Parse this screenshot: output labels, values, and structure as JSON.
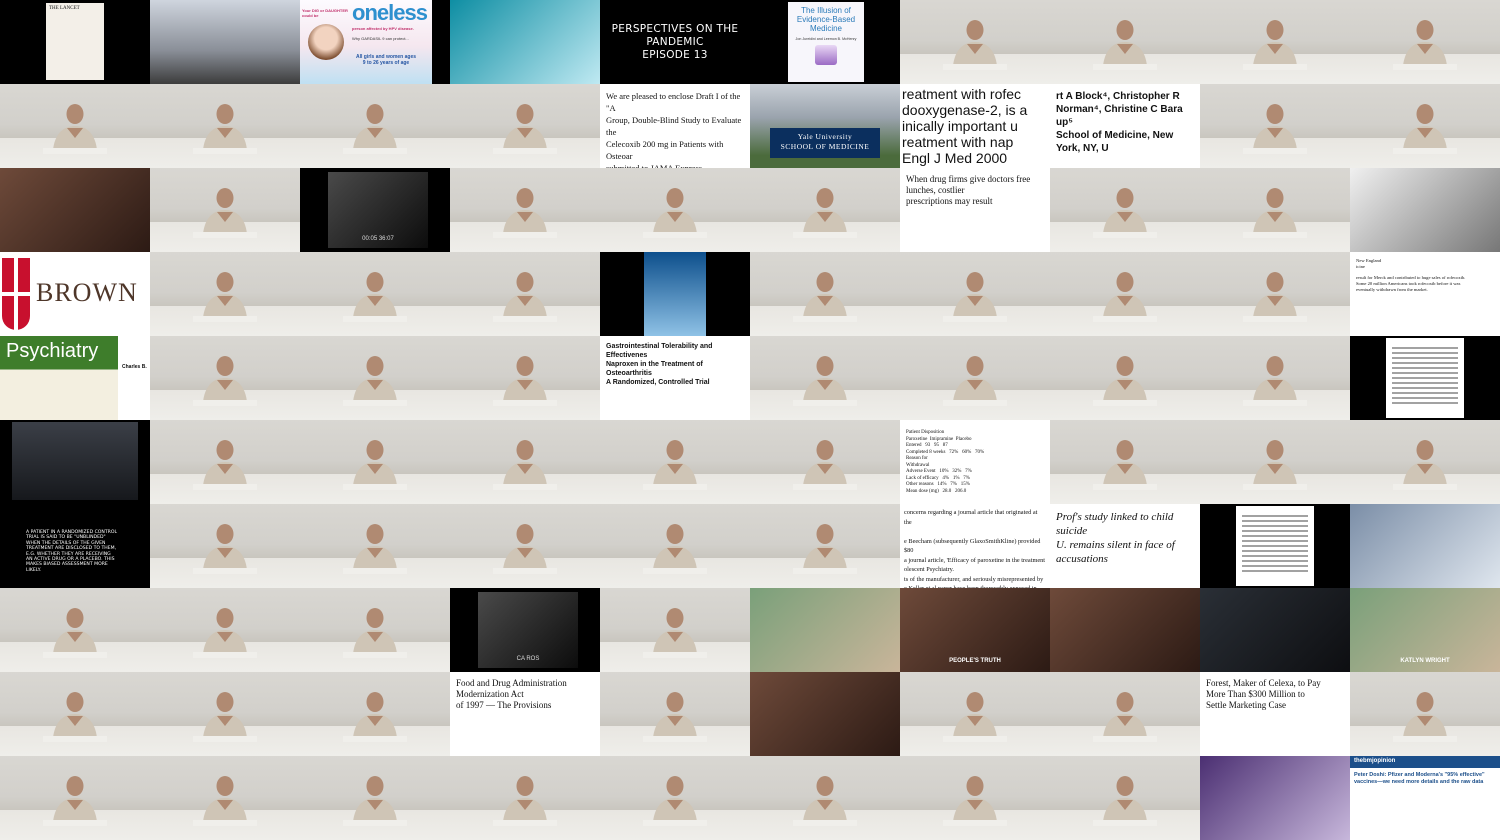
{
  "tiles": [
    {
      "type": "doc",
      "text": "THE LANCET"
    },
    {
      "type": "photo",
      "variant": "photo-street"
    },
    {
      "type": "ad",
      "brand": "oneless",
      "top": "Your DIG or DAUGHTER could be",
      "sub": "person affected by HPV disease.",
      "mid": "Why GARDASIL 9 can protect...",
      "low": "All girls and women ages\n9 to 26 years of age"
    },
    {
      "type": "photo",
      "variant": "photo-cyan"
    },
    {
      "type": "title",
      "line1": "PERSPECTIVES ON THE PANDEMIC",
      "line2": "EPISODE 13"
    },
    {
      "type": "book",
      "title": "The Illusion of\nEvidence-Based\nMedicine",
      "authors": "Jon Jureidini and Leemon B. McHenry"
    },
    {
      "type": "speaker"
    },
    {
      "type": "speaker"
    },
    {
      "type": "speaker"
    },
    {
      "type": "speaker"
    },
    {
      "type": "speaker"
    },
    {
      "type": "speaker"
    },
    {
      "type": "speaker"
    },
    {
      "type": "speaker"
    },
    {
      "type": "doc",
      "text": "We are pleased to enclose Draft I of the \"A\nGroup, Double-Blind Study to Evaluate the\nCelecoxib 200 mg in Patients with Osteoar\nsubmitted to JAMA Express.\n\nPlease feel free to mark your revisions direc\n\nWe look forward to receiving your commen"
    },
    {
      "type": "sign",
      "text": "Yale University\nSCHOOL OF MEDICINE"
    },
    {
      "type": "doc",
      "text": "reatment with rofec\ndooxygenase-2, is a\ninically important u\nreatment with nap\nEngl J Med 2000"
    },
    {
      "type": "doc",
      "text": "rt A Block⁴, Christopher R\nNorman⁴, Christine C Bara\nup⁵\nSchool of Medicine, New York, NY, U"
    },
    {
      "type": "speaker"
    },
    {
      "type": "speaker"
    },
    {
      "type": "photo",
      "variant": "photo-warm"
    },
    {
      "type": "speaker"
    },
    {
      "type": "film",
      "text": "00:05 36:07"
    },
    {
      "type": "speaker"
    },
    {
      "type": "speaker"
    },
    {
      "type": "speaker"
    },
    {
      "type": "doc",
      "text": "When drug firms give doctors free lunches, costlier\nprescriptions may result"
    },
    {
      "type": "speaker"
    },
    {
      "type": "speaker"
    },
    {
      "type": "photo",
      "variant": "photo-bw"
    },
    {
      "type": "brown",
      "text": "BROWN"
    },
    {
      "type": "speaker"
    },
    {
      "type": "speaker"
    },
    {
      "type": "speaker"
    },
    {
      "type": "poster",
      "variant": "photo-blue"
    },
    {
      "type": "speaker"
    },
    {
      "type": "speaker"
    },
    {
      "type": "speaker"
    },
    {
      "type": "speaker"
    },
    {
      "type": "doc",
      "text": "New England\nicine\n\nresult for Merck and contributed to huge sales of rofecoxib.\nSome 20 million Americans took rofecoxib before it was\neventually withdrawn from the market."
    },
    {
      "type": "journal",
      "text": "Psychiatry",
      "name": "Charles B."
    },
    {
      "type": "speaker"
    },
    {
      "type": "speaker"
    },
    {
      "type": "speaker"
    },
    {
      "type": "doc",
      "text": "Gastrointestinal Tolerability and Effectivenes\nNaproxen in the Treatment of Osteoarthritis\nA Randomized, Controlled Trial"
    },
    {
      "type": "speaker"
    },
    {
      "type": "speaker"
    },
    {
      "type": "speaker"
    },
    {
      "type": "speaker"
    },
    {
      "type": "paper"
    },
    {
      "type": "web"
    },
    {
      "type": "speaker"
    },
    {
      "type": "speaker"
    },
    {
      "type": "speaker"
    },
    {
      "type": "speaker"
    },
    {
      "type": "speaker"
    },
    {
      "type": "table",
      "text": "Patient Disposition\nParoxetine  Imipramine  Placebo\nEntered   93   95   87\nCompleted 8 weeks   72%   60%   70%\nReason for\nWithdrawal\nAdverse Event   10%   32%   7%\nLack of efficacy   4%   1%   7%\nOther reasons   14%   7%   15%\nMean dose (mg)   28.0   206.0"
    },
    {
      "type": "speaker"
    },
    {
      "type": "speaker"
    },
    {
      "type": "speaker"
    },
    {
      "type": "caption",
      "text": "A PATIENT IN A RANDOMIZED CONTROL TRIAL IS SAID TO BE \"UNBLINDED\" WHEN THE DETAILS OF THE GIVEN TREATMENT ARE DISCLOSED TO THEM, E.G. WHETHER THEY ARE RECEIVING AN ACTIVE DRUG OR A PLACEBO. THIS MAKES BIASED ASSESSMENT MORE LIKELY."
    },
    {
      "type": "speaker"
    },
    {
      "type": "speaker"
    },
    {
      "type": "speaker"
    },
    {
      "type": "speaker"
    },
    {
      "type": "speaker"
    },
    {
      "type": "doc",
      "text": "concerns regarding a journal article that originated at the\n\ne Beecham (subsequently GlaxoSmithKline) provided $80\na journal article, 'Efficacy of paroxetine in the treatment\nolescent Psychiatry.\nts of the manufacturer, and seriously misrepresented by\ne Keller et al paper have been thoroughly exposed in\nver continues to be cited uncritically in the medical literatu\nolescents are being harmed because well-intentioned phy"
    },
    {
      "type": "news",
      "text": "Prof's study linked to child suicide\nU. remains silent in face of accusations"
    },
    {
      "type": "paper"
    },
    {
      "type": "photo",
      "variant": "photo-lab"
    },
    {
      "type": "speaker"
    },
    {
      "type": "speaker"
    },
    {
      "type": "speaker"
    },
    {
      "type": "film",
      "text": "CA ROS"
    },
    {
      "type": "speaker"
    },
    {
      "type": "photo",
      "variant": "photo-green"
    },
    {
      "type": "photo",
      "variant": "photo-warm",
      "text": "PEOPLE'S TRUTH"
    },
    {
      "type": "photo",
      "variant": "photo-warm"
    },
    {
      "type": "photo",
      "variant": "photo-dark"
    },
    {
      "type": "photo",
      "variant": "photo-green",
      "text": "KATLYN WRIGHT"
    },
    {
      "type": "speaker"
    },
    {
      "type": "speaker"
    },
    {
      "type": "speaker"
    },
    {
      "type": "doc",
      "text": "Food and Drug Administration Modernization Act\nof 1997 — The Provisions"
    },
    {
      "type": "speaker"
    },
    {
      "type": "photo",
      "variant": "photo-warm"
    },
    {
      "type": "speaker"
    },
    {
      "type": "speaker"
    },
    {
      "type": "doc",
      "text": "Forest, Maker of Celexa, to Pay\nMore Than $300 Million to\nSettle Marketing Case"
    },
    {
      "type": "speaker"
    },
    {
      "type": "speaker"
    },
    {
      "type": "speaker"
    },
    {
      "type": "speaker"
    },
    {
      "type": "speaker"
    },
    {
      "type": "speaker"
    },
    {
      "type": "speaker"
    },
    {
      "type": "speaker"
    },
    {
      "type": "speaker"
    },
    {
      "type": "photo",
      "variant": "photo-vlt"
    },
    {
      "type": "bmj",
      "brand": "thebmjopinion",
      "text": "Peter Doshi: Pfizer and Moderna's \"95% effective\" vaccines—we need more details and the raw data"
    }
  ]
}
